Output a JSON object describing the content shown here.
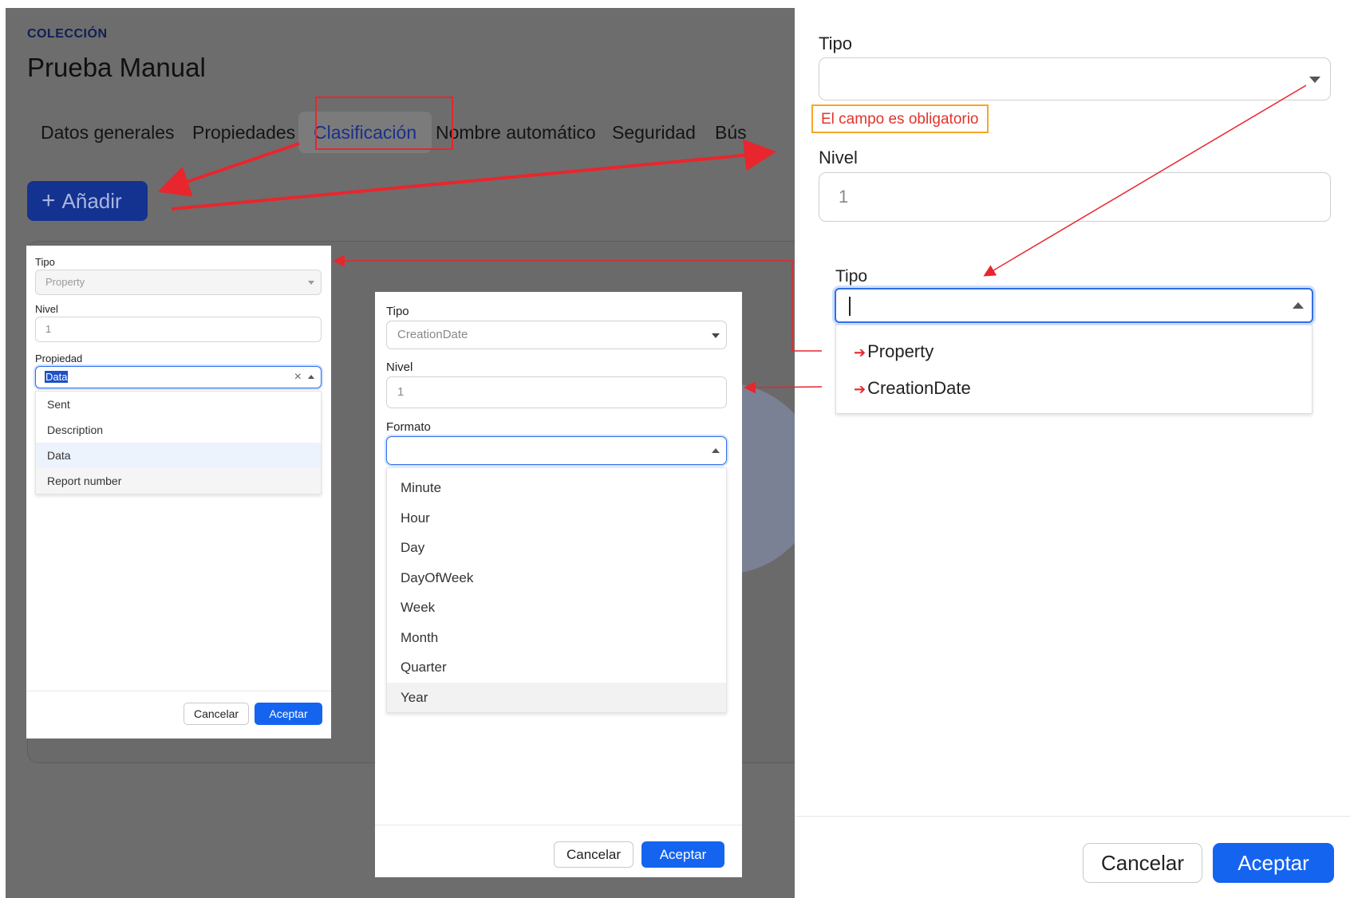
{
  "background": {
    "collection_label": "COLECCIÓN",
    "title": "Prueba Manual",
    "tabs": [
      {
        "label": "Datos generales"
      },
      {
        "label": "Propiedades"
      },
      {
        "label": "Clasificación"
      },
      {
        "label": "Nombre automático"
      },
      {
        "label": "Seguridad"
      },
      {
        "label": "Bús"
      }
    ],
    "add_button": {
      "icon": "+",
      "label": "Añadir"
    }
  },
  "right_panel": {
    "tipo_label": "Tipo",
    "tipo_value": "",
    "required_message": "El campo es obligatorio",
    "nivel_label": "Nivel",
    "nivel_value": "1",
    "zoom_tipo_label": "Tipo",
    "options": [
      {
        "arrow": "➔",
        "label": "Property"
      },
      {
        "arrow": "➔",
        "label": "CreationDate"
      }
    ],
    "cancel_label": "Cancelar",
    "accept_label": "Aceptar"
  },
  "dialog_property": {
    "tipo_label": "Tipo",
    "tipo_value": "Property",
    "nivel_label": "Nivel",
    "nivel_value": "1",
    "propiedad_label": "Propiedad",
    "propiedad_value": "Data",
    "clear_icon": "×",
    "options": [
      {
        "label": "Sent"
      },
      {
        "label": "Description"
      },
      {
        "label": "Data"
      },
      {
        "label": "Report number"
      }
    ],
    "cancel_label": "Cancelar",
    "accept_label": "Aceptar"
  },
  "dialog_creationdate": {
    "tipo_label": "Tipo",
    "tipo_value": "CreationDate",
    "nivel_label": "Nivel",
    "nivel_value": "1",
    "formato_label": "Formato",
    "formato_value": "",
    "options": [
      {
        "label": "Minute"
      },
      {
        "label": "Hour"
      },
      {
        "label": "Day"
      },
      {
        "label": "DayOfWeek"
      },
      {
        "label": "Week"
      },
      {
        "label": "Month"
      },
      {
        "label": "Quarter"
      },
      {
        "label": "Year"
      }
    ],
    "cancel_label": "Cancelar",
    "accept_label": "Aceptar"
  },
  "colors": {
    "accent": "#1464f0",
    "annotation_red": "#e8262d",
    "highlight_box": "#f6a623",
    "overlay": "#6d6d6d"
  }
}
